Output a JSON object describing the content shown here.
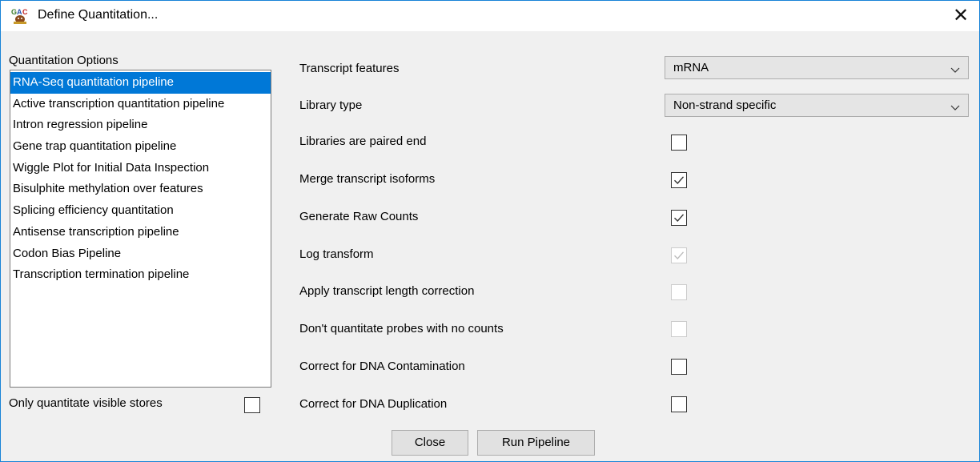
{
  "window": {
    "title": "Define Quantitation...",
    "close_glyph": "✕",
    "icon": "seqmonk-app-icon",
    "border_color": "#1883d7"
  },
  "options": {
    "label": "Quantitation Options",
    "selected_color": "#0078d7",
    "items": [
      {
        "label": "RNA-Seq quantitation pipeline",
        "selected": true
      },
      {
        "label": "Active transcription quantitation pipeline",
        "selected": false
      },
      {
        "label": "Intron regression pipeline",
        "selected": false
      },
      {
        "label": "Gene trap quantitation pipeline",
        "selected": false
      },
      {
        "label": "Wiggle Plot for Initial Data Inspection",
        "selected": false
      },
      {
        "label": "Bisulphite methylation over features",
        "selected": false
      },
      {
        "label": "Splicing efficiency quantitation",
        "selected": false
      },
      {
        "label": "Antisense transcription pipeline",
        "selected": false
      },
      {
        "label": "Codon Bias Pipeline",
        "selected": false
      },
      {
        "label": "Transcription termination pipeline",
        "selected": false
      }
    ]
  },
  "visible_stores": {
    "label": "Only quantitate visible stores",
    "checked": false
  },
  "settings": {
    "transcript_features": {
      "label": "Transcript features",
      "value": "mRNA"
    },
    "library_type": {
      "label": "Library type",
      "value": "Non-strand specific"
    },
    "paired_end": {
      "label": "Libraries are paired end",
      "checked": false,
      "enabled": true
    },
    "merge_isoforms": {
      "label": "Merge transcript isoforms",
      "checked": true,
      "enabled": true
    },
    "raw_counts": {
      "label": "Generate Raw Counts",
      "checked": true,
      "enabled": true
    },
    "log_transform": {
      "label": "Log transform",
      "checked": true,
      "enabled": false
    },
    "length_correction": {
      "label": "Apply transcript length correction",
      "checked": false,
      "enabled": false
    },
    "no_counts": {
      "label": "Don't quantitate probes with no counts",
      "checked": false,
      "enabled": false
    },
    "dna_contamination": {
      "label": "Correct for DNA Contamination",
      "checked": false,
      "enabled": true
    },
    "dna_duplication": {
      "label": "Correct for DNA Duplication",
      "checked": false,
      "enabled": true
    }
  },
  "buttons": {
    "close": "Close",
    "run": "Run Pipeline"
  }
}
